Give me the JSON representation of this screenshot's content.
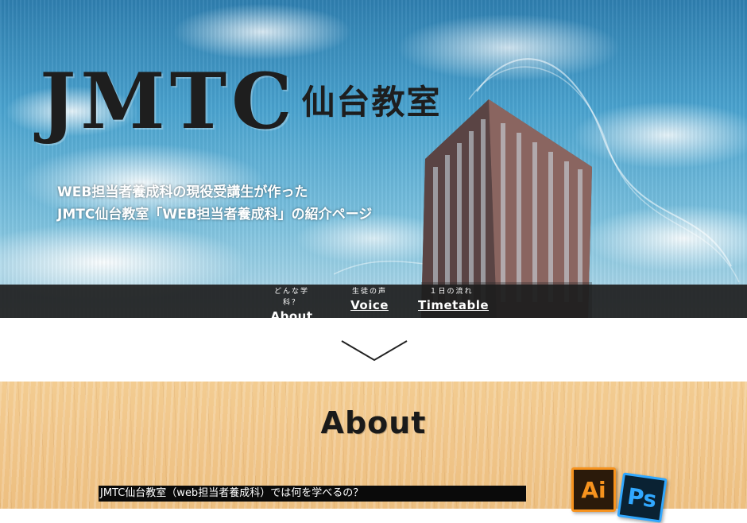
{
  "hero": {
    "logo_big": "JMTC",
    "logo_small": "仙台教室",
    "tagline_line1": "WEB担当者養成科の現役受講生が作った",
    "tagline_line2": "JMTC仙台教室「WEB担当者養成科」の紹介ページ"
  },
  "nav": {
    "items": [
      {
        "sub": "どんな学科？",
        "label": "About"
      },
      {
        "sub": "生徒の声",
        "label": "Voice"
      },
      {
        "sub": "１日の流れ",
        "label": "Timetable"
      }
    ]
  },
  "about": {
    "title": "About",
    "question": "JMTC仙台教室（web担当者養成科）では何を学べるの？",
    "icons": [
      {
        "name": "illustrator-icon",
        "text": "Ai",
        "color": "#f7931e"
      },
      {
        "name": "photoshop-icon",
        "text": "Ps",
        "color": "#31a8ff"
      }
    ]
  },
  "colors": {
    "nav_bg": "#1e1e1e",
    "wood": "#f0c589",
    "sky": "#4aa3cf"
  }
}
